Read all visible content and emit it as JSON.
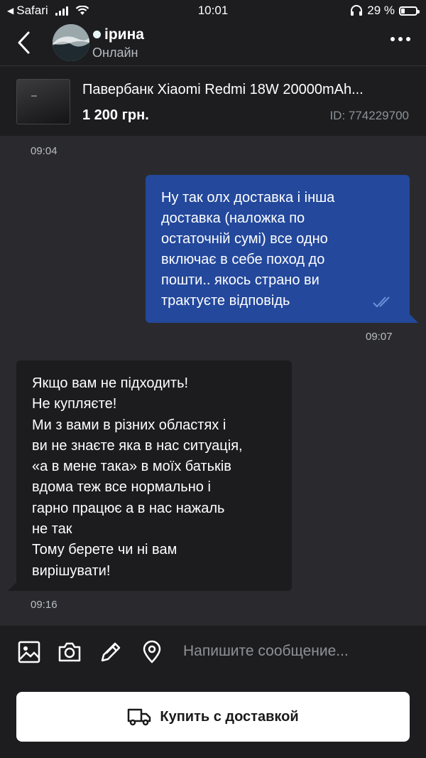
{
  "status_bar": {
    "back_app": "Safari",
    "time": "10:01",
    "battery": "29 %",
    "battery_level": 0.29
  },
  "header": {
    "name": "ірина",
    "status": "Онлайн"
  },
  "product": {
    "title": "Павербанк Xiaomi Redmi 18W 20000mAh...",
    "price": "1 200 грн.",
    "id": "ID: 774229700"
  },
  "messages": {
    "first_time": "09:04",
    "outgoing": {
      "lines": [
        "Ну так олх доставка і інша",
        "доставка (наложка по",
        "остаточній сумі) все одно",
        "включає в себе поход до",
        "пошти.. якось страно ви",
        "трактуєте відповідь"
      ],
      "time": "09:07"
    },
    "incoming": {
      "lines": [
        "Якщо вам не підходить!",
        "Не купляєте!",
        "Ми з вами в різних областях і",
        "ви не знаєте яка в нас ситуація,",
        "«а в мене така» в моїх батьків",
        "вдома теж все нормально і",
        "гарно працює а в нас нажаль",
        "не так",
        "Тому берете чи ні вам",
        "вирішувати!"
      ],
      "time": "09:16"
    }
  },
  "composer": {
    "placeholder": "Напишите сообщение...",
    "icons": [
      "image-icon",
      "camera-icon",
      "pencil-icon",
      "location-pin-icon"
    ]
  },
  "buy_button": {
    "label": "Купить с доставкой",
    "icon": "truck-icon"
  },
  "colors": {
    "outgoing_bubble": "#23489c",
    "incoming_bubble": "#1c1c1f",
    "background": "#2a2a2e",
    "read_check": "#6d8fd9"
  }
}
